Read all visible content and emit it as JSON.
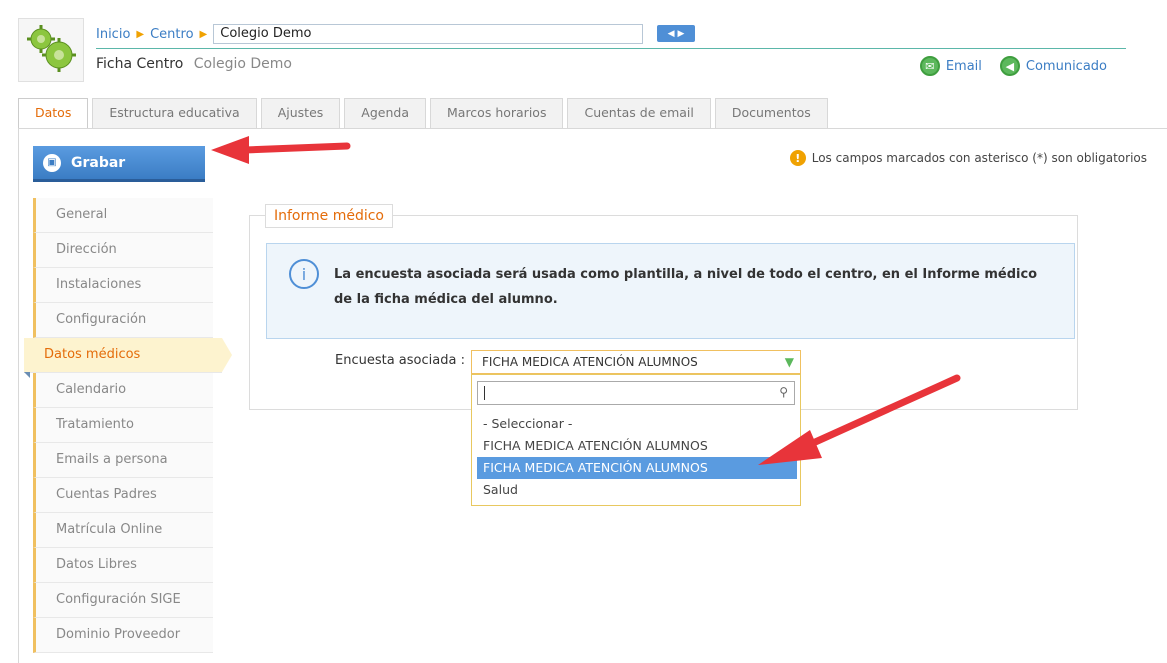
{
  "header": {
    "breadcrumb": {
      "home": "Inicio",
      "section": "Centro",
      "current": "Colegio Demo"
    },
    "title": "Ficha Centro",
    "subtitle": "Colegio Demo",
    "actions": {
      "email": "Email",
      "notice": "Comunicado"
    }
  },
  "tabs": [
    {
      "label": "Datos",
      "active": true
    },
    {
      "label": "Estructura educativa"
    },
    {
      "label": "Ajustes"
    },
    {
      "label": "Agenda"
    },
    {
      "label": "Marcos horarios"
    },
    {
      "label": "Cuentas de email"
    },
    {
      "label": "Documentos"
    }
  ],
  "toolbar": {
    "save_label": "Grabar",
    "required_note": "Los campos marcados con asterisco (*) son obligatorios"
  },
  "sidebar": {
    "items": [
      {
        "label": "General"
      },
      {
        "label": "Dirección"
      },
      {
        "label": "Instalaciones"
      },
      {
        "label": "Configuración"
      },
      {
        "label": "Datos médicos",
        "active": true
      },
      {
        "label": "Calendario"
      },
      {
        "label": "Tratamiento"
      },
      {
        "label": "Emails a persona"
      },
      {
        "label": "Cuentas Padres"
      },
      {
        "label": "Matrícula Online"
      },
      {
        "label": "Datos Libres"
      },
      {
        "label": "Configuración SIGE"
      },
      {
        "label": "Dominio Proveedor"
      }
    ]
  },
  "panel": {
    "legend": "Informe médico",
    "info": "La encuesta asociada será usada como plantilla, a nivel de todo el centro, en el Informe médico de la ficha médica del alumno.",
    "field_label": "Encuesta asociada :",
    "selected_value": "FICHA MEDICA ATENCIÓN ALUMNOS",
    "dropdown_options": [
      {
        "label": "- Seleccionar -"
      },
      {
        "label": "FICHA MEDICA ATENCIÓN ALUMNOS"
      },
      {
        "label": "FICHA MEDICA ATENCIÓN ALUMNOS",
        "highlighted": true
      },
      {
        "label": "Salud"
      }
    ]
  },
  "colors": {
    "accent_orange": "#e46c0a",
    "primary_blue": "#3b7dc4",
    "highlight_blue": "#5a9be0",
    "annotation_red": "#e8343a"
  },
  "icons": {
    "logo": "gears-icon",
    "email": "envelope-icon",
    "notice": "megaphone-icon",
    "save": "floppy-disk-icon",
    "warning": "exclamation-icon",
    "info": "info-icon",
    "search": "search-icon"
  }
}
